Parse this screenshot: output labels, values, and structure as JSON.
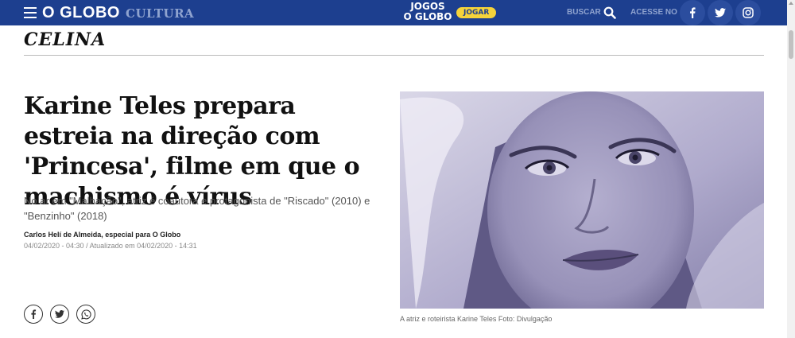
{
  "header": {
    "logo": "O GLOBO",
    "section": "CULTURA",
    "jogos_line1": "JOGOS",
    "jogos_line2": "O GLOBO",
    "jogar_label": "JOGAR",
    "buscar_label": "BUSCAR",
    "acesse_label": "ACESSE NO",
    "brand_color": "#1d3f8f"
  },
  "column": {
    "name": "CELINA"
  },
  "article": {
    "headline": "Karine Teles prepara estreia na direção com 'Princesa', filme em que o machismo é vírus",
    "subtitle": "No ar em \"Malhação\", atriz é coautora e protagonista de \"Riscado\" (2010) e \"Benzinho\" (2018)",
    "author": "Carlos Helí de Almeida, especial para O Globo",
    "dates": "04/02/2020 - 04:30 / Atualizado em 04/02/2020 - 14:31",
    "photo_caption": "A atriz e roteirista Karine Teles Foto: Divulgação"
  },
  "share_icons": [
    "facebook-icon",
    "twitter-icon",
    "whatsapp-icon"
  ]
}
